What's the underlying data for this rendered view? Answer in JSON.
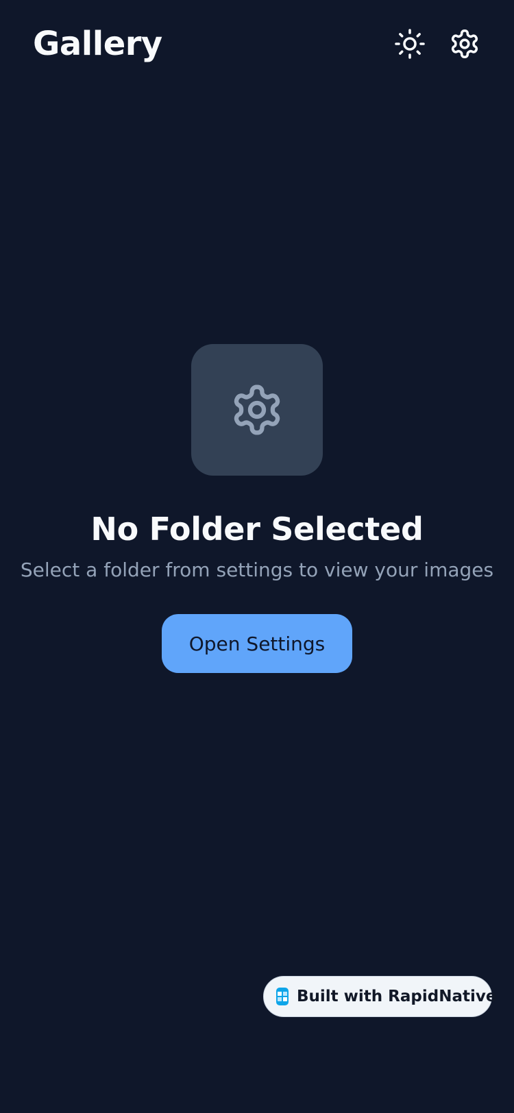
{
  "header": {
    "title": "Gallery",
    "icons": [
      "sun-icon",
      "gear-icon"
    ]
  },
  "empty_state": {
    "icon": "gear-icon",
    "title": "No Folder Selected",
    "subtitle": "Select a folder from settings to view your images",
    "button_label": "Open Settings"
  },
  "badge": {
    "label": "Built with RapidNative",
    "icon": "rapidnative-logo-icon"
  },
  "colors": {
    "background": "#0f172a",
    "card": "#334155",
    "accent": "#60a5fa",
    "muted_text": "#94a3b8",
    "badge_bg": "#f1f5f9",
    "logo": "#0ea5e9"
  }
}
